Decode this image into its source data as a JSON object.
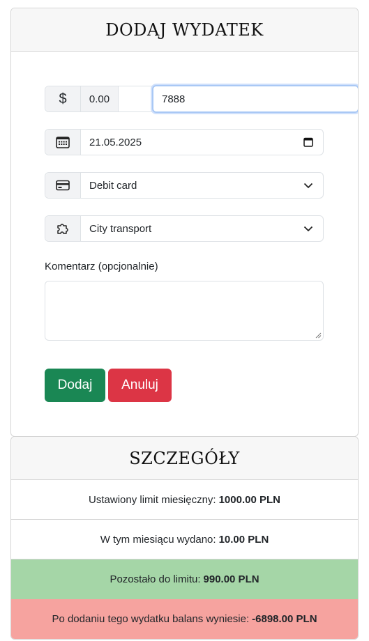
{
  "add_card": {
    "title": "DODAJ WYDATEK",
    "amount": {
      "currency_symbol": "$",
      "prefix_value": "0.00",
      "value": "7888"
    },
    "date": {
      "value": "21.05.2025"
    },
    "payment_method": {
      "selected": "Debit card"
    },
    "category": {
      "selected": "City transport"
    },
    "comment": {
      "label": "Komentarz (opcjonalnie)",
      "value": ""
    },
    "buttons": {
      "add": "Dodaj",
      "cancel": "Anuluj"
    }
  },
  "details_card": {
    "title": "SZCZEGÓŁY",
    "rows": [
      {
        "label": "Ustawiony limit miesięczny:",
        "value": "1000.00 PLN"
      },
      {
        "label": "W tym miesiącu wydano:",
        "value": "10.00 PLN"
      },
      {
        "label": "Pozostało do limitu:",
        "value": "990.00 PLN"
      },
      {
        "label": "Po dodaniu tego wydatku balans wyniesie:",
        "value": "-6898.00 PLN"
      }
    ]
  },
  "colors": {
    "success": "#1a8754",
    "danger": "#dc3545",
    "remaining_bg": "#a5d6a7",
    "balance_bg": "#f6a39f"
  },
  "icons": [
    "dollar-icon",
    "calendar-icon",
    "credit-card-icon",
    "puzzle-icon",
    "calendar-picker-icon",
    "chevron-down-icon"
  ]
}
